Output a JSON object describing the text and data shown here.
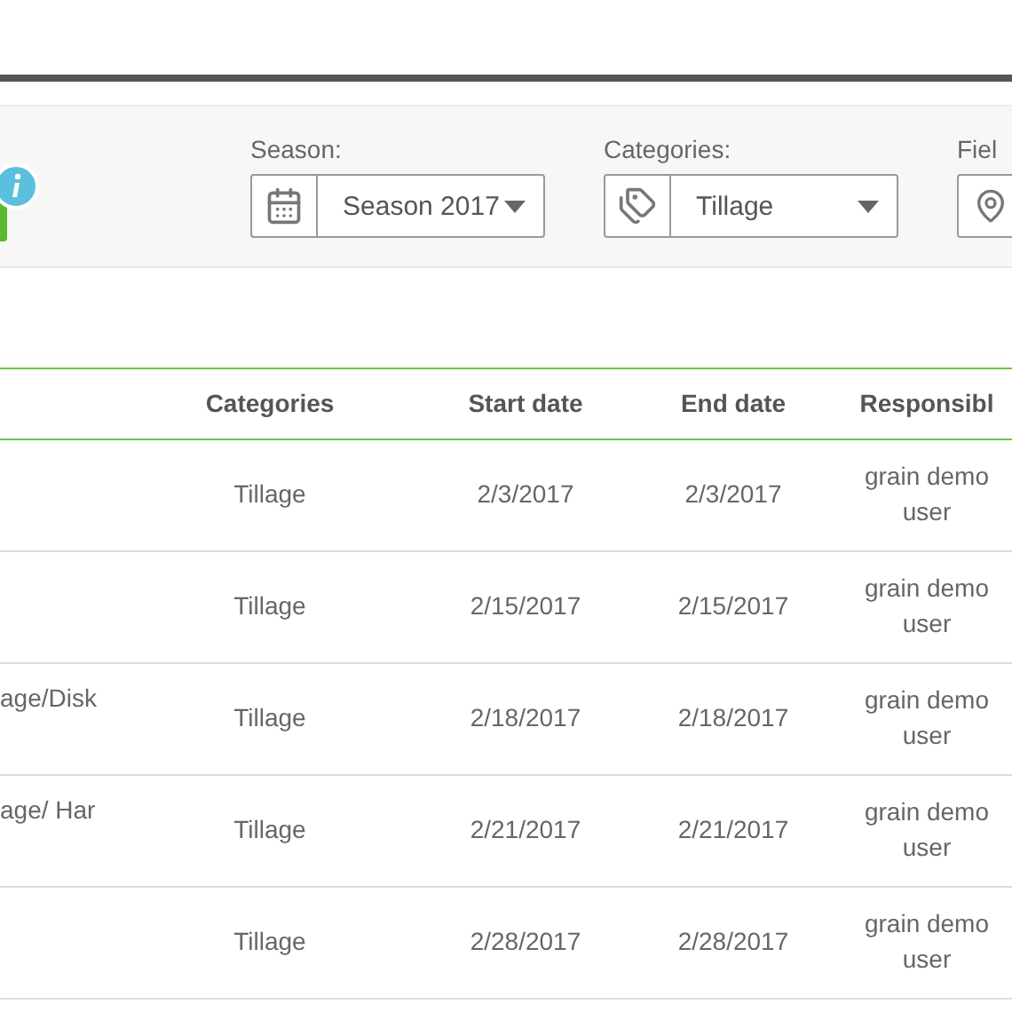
{
  "filters": [
    {
      "kind": "season",
      "label": "Season:",
      "value": "Season 2017"
    },
    {
      "kind": "category",
      "label": "Categories:",
      "value": "Tillage"
    },
    {
      "kind": "field",
      "label": "Fiel"
    }
  ],
  "table": {
    "columns": [
      "",
      "Categories",
      "Start date",
      "End date",
      "Responsibl"
    ],
    "rows": [
      [
        "",
        "Tillage",
        "2/3/2017",
        "2/3/2017",
        "grain demo\nuser"
      ],
      [
        "",
        "Tillage",
        "2/15/2017",
        "2/15/2017",
        "grain demo\nuser"
      ],
      [
        "age/Disk",
        "Tillage",
        "2/18/2017",
        "2/18/2017",
        "grain demo\nuser"
      ],
      [
        "age/ Har",
        "Tillage",
        "2/21/2017",
        "2/21/2017",
        "grain demo\nuser"
      ],
      [
        "",
        "Tillage",
        "2/28/2017",
        "2/28/2017",
        "grain demo\nuser"
      ]
    ]
  }
}
